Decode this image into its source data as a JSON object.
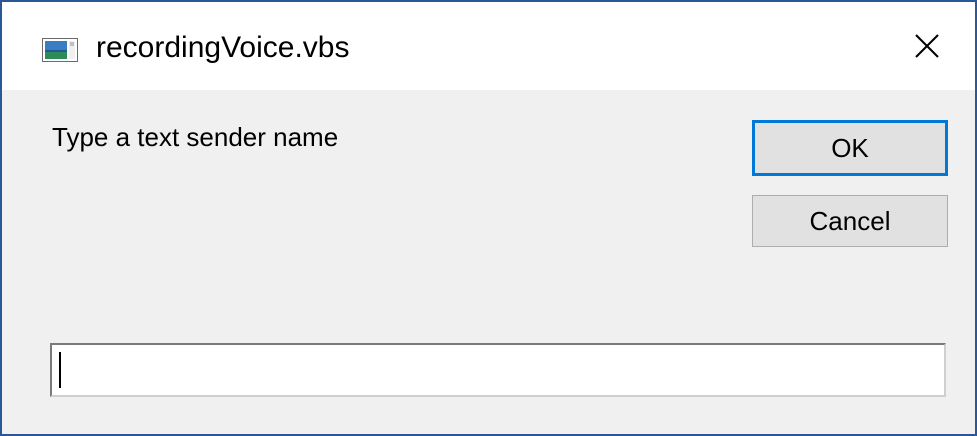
{
  "window": {
    "title": "recordingVoice.vbs",
    "icon": "vbs-script-window-icon",
    "close_icon": "close-icon",
    "border_color": "#2b5797"
  },
  "dialog": {
    "prompt": "Type a text sender name",
    "ok_label": "OK",
    "cancel_label": "Cancel",
    "input_value": "",
    "focus_color": "#0078d7"
  }
}
